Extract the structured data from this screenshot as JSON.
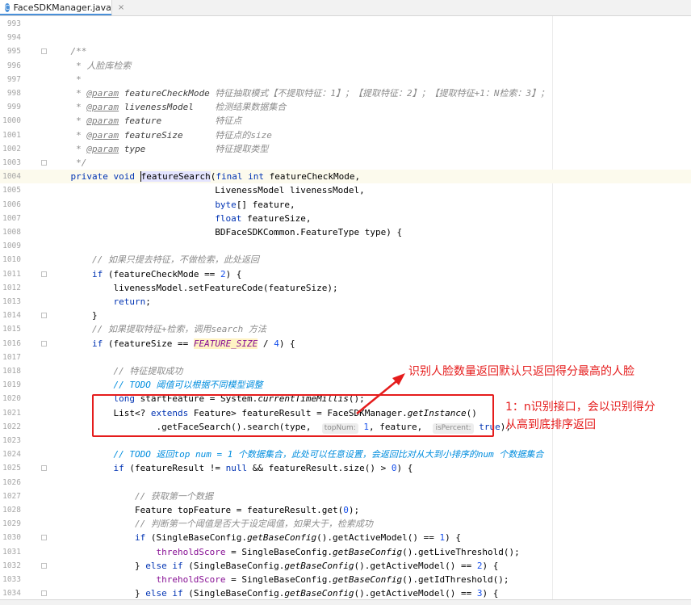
{
  "tab": {
    "icon": "C",
    "filename": "FaceSDKManager.java",
    "close": "×"
  },
  "lines": [
    {
      "n": "993",
      "html": ""
    },
    {
      "n": "994",
      "html": ""
    },
    {
      "n": "995",
      "html": "    <span class='c'>/**</span>",
      "fold": true
    },
    {
      "n": "996",
      "html": "     <span class='c'>* 人脸库检索</span>"
    },
    {
      "n": "997",
      "html": "     <span class='c'>*</span>"
    },
    {
      "n": "998",
      "html": "     <span class='c'>* </span><span class='tag'>@param</span> <span class='pname'>featureCheckMode</span> <span class='c'>特征抽取模式【不提取特征：1】；【提取特征：2】；【提取特征+1：N检索：3】；</span>"
    },
    {
      "n": "999",
      "html": "     <span class='c'>* </span><span class='tag'>@param</span> <span class='pname'>livenessModel</span>    <span class='c'>检测结果数据集合</span>"
    },
    {
      "n": "1000",
      "html": "     <span class='c'>* </span><span class='tag'>@param</span> <span class='pname'>feature</span>          <span class='c'>特征点</span>"
    },
    {
      "n": "1001",
      "html": "     <span class='c'>* </span><span class='tag'>@param</span> <span class='pname'>featureSize</span>      <span class='c'>特征点的size</span>"
    },
    {
      "n": "1002",
      "html": "     <span class='c'>* </span><span class='tag'>@param</span> <span class='pname'>type</span>             <span class='c'>特征提取类型</span>"
    },
    {
      "n": "1003",
      "html": "     <span class='c'>*/</span>",
      "fold": true
    },
    {
      "n": "1004",
      "html": "    <span class='kw'>private</span> <span class='kw'>void</span> <span class='caret'></span><span class='ident-hl'>featureSearch</span>(<span class='kw'>final</span> <span class='kw'>int</span> featureCheckMode,",
      "current": true
    },
    {
      "n": "1005",
      "html": "                               LivenessModel livenessModel,"
    },
    {
      "n": "1006",
      "html": "                               <span class='kw'>byte</span>[] feature,"
    },
    {
      "n": "1007",
      "html": "                               <span class='kw'>float</span> featureSize,"
    },
    {
      "n": "1008",
      "html": "                               BDFaceSDKCommon.FeatureType type) {"
    },
    {
      "n": "1009",
      "html": ""
    },
    {
      "n": "1010",
      "html": "        <span class='c'>// 如果只提去特征，不做检索，此处返回</span>"
    },
    {
      "n": "1011",
      "html": "        <span class='kw'>if</span> (featureCheckMode == <span class='num'>2</span>) {",
      "fold": true
    },
    {
      "n": "1012",
      "html": "            livenessModel.setFeatureCode(featureSize);"
    },
    {
      "n": "1013",
      "html": "            <span class='kw'>return</span>;"
    },
    {
      "n": "1014",
      "html": "        }",
      "fold": true
    },
    {
      "n": "1015",
      "html": "        <span class='c'>// 如果提取特征+检索，调用search 方法</span>"
    },
    {
      "n": "1016",
      "html": "        <span class='kw'>if</span> (featureSize == <span class='const'>FEATURE_SIZE</span> / <span class='num'>4</span>) {",
      "fold": true
    },
    {
      "n": "1017",
      "html": ""
    },
    {
      "n": "1018",
      "html": "            <span class='c'>// 特征提取成功</span>"
    },
    {
      "n": "1019",
      "html": "            <span class='todo'>// TODO 阈值可以根据不同模型调整</span>"
    },
    {
      "n": "1020",
      "html": "            <span class='kw'>long</span> startFeature = System.<span class='itl'>currentTimeMillis</span>();"
    },
    {
      "n": "1021",
      "html": "            List&lt;? <span class='kw'>extends</span> Feature&gt; featureResult = FaceSDKManager.<span class='itl'>getInstance</span>()"
    },
    {
      "n": "1022",
      "html": "                    .getFaceSearch().search(type,  <span class='hint'>topNum:</span> <span class='num'>1</span>, feature,  <span class='hint'>isPercent:</span> <span class='kw'>true</span>);"
    },
    {
      "n": "1023",
      "html": ""
    },
    {
      "n": "1024",
      "html": "            <span class='todo'>// TODO 返回top num = 1 个数据集合，此处可以任意设置，会返回比对从大到小排序的num 个数据集合</span>"
    },
    {
      "n": "1025",
      "html": "            <span class='kw'>if</span> (featureResult != <span class='kw'>null</span> &amp;&amp; featureResult.size() &gt; <span class='num'>0</span>) {",
      "fold": true
    },
    {
      "n": "1026",
      "html": ""
    },
    {
      "n": "1027",
      "html": "                <span class='c'>// 获取第一个数据</span>"
    },
    {
      "n": "1028",
      "html": "                Feature topFeature = featureResult.get(<span class='num'>0</span>);"
    },
    {
      "n": "1029",
      "html": "                <span class='c'>// 判断第一个阈值是否大于设定阈值，如果大于，检索成功</span>"
    },
    {
      "n": "1030",
      "html": "                <span class='kw'>if</span> (SingleBaseConfig.<span class='itl'>getBaseConfig</span>().getActiveModel() == <span class='num'>1</span>) {",
      "fold": true
    },
    {
      "n": "1031",
      "html": "                    <span class='fld'>threholdScore</span> = SingleBaseConfig.<span class='itl'>getBaseConfig</span>().getLiveThreshold();"
    },
    {
      "n": "1032",
      "html": "                } <span class='kw'>else if</span> (SingleBaseConfig.<span class='itl'>getBaseConfig</span>().getActiveModel() == <span class='num'>2</span>) {",
      "fold": true
    },
    {
      "n": "1033",
      "html": "                    <span class='fld'>threholdScore</span> = SingleBaseConfig.<span class='itl'>getBaseConfig</span>().getIdThreshold();"
    },
    {
      "n": "1034",
      "html": "                } <span class='kw'>else if</span> (SingleBaseConfig.<span class='itl'>getBaseConfig</span>().getActiveModel() == <span class='num'>3</span>) {",
      "fold": true
    }
  ],
  "annotations": {
    "note1": "识别人脸数量返回默认只返回得分最高的人脸",
    "note2_line1": "1：n识别接口，会以识别得分",
    "note2_line2": "从高到底排序返回"
  },
  "colors": {
    "accent": "#e51c1c",
    "keyword": "#0033b3",
    "comment": "#8c8c8c"
  }
}
